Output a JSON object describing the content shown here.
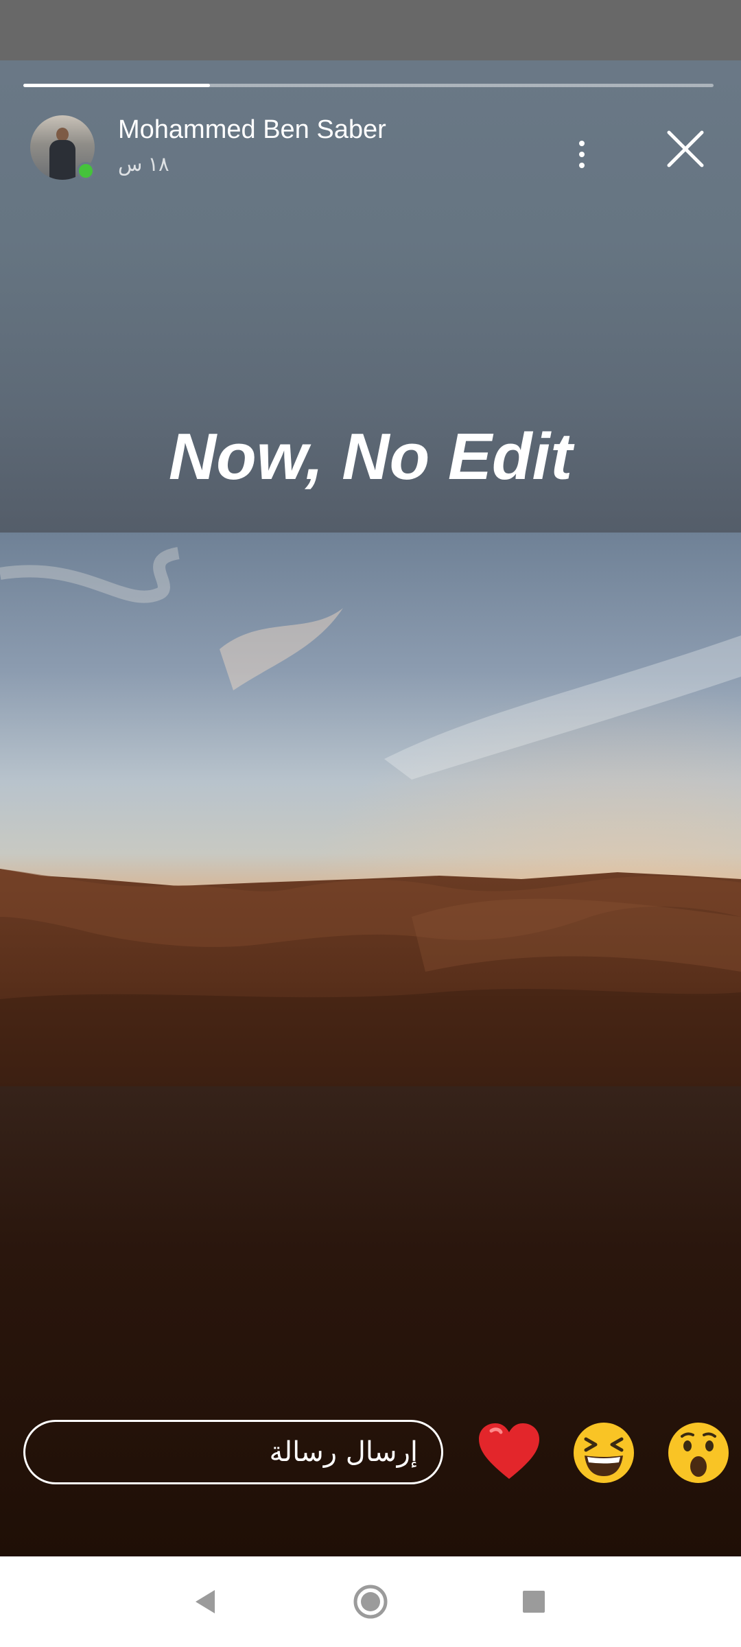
{
  "story": {
    "progress_fraction": 0.27,
    "author": {
      "name": "Mohammed Ben Saber",
      "time_ago": "١٨ س",
      "online": true
    },
    "caption": "Now, No Edit"
  },
  "reply": {
    "placeholder": "إرسال رسالة",
    "reactions": [
      "heart-emoji",
      "laughing-emoji",
      "surprised-emoji"
    ]
  },
  "colors": {
    "online_dot": "#45c33b",
    "progress_fill": "#ffffff",
    "nav_bar": "#ffffff",
    "reply_bg": "#1f0f06"
  }
}
